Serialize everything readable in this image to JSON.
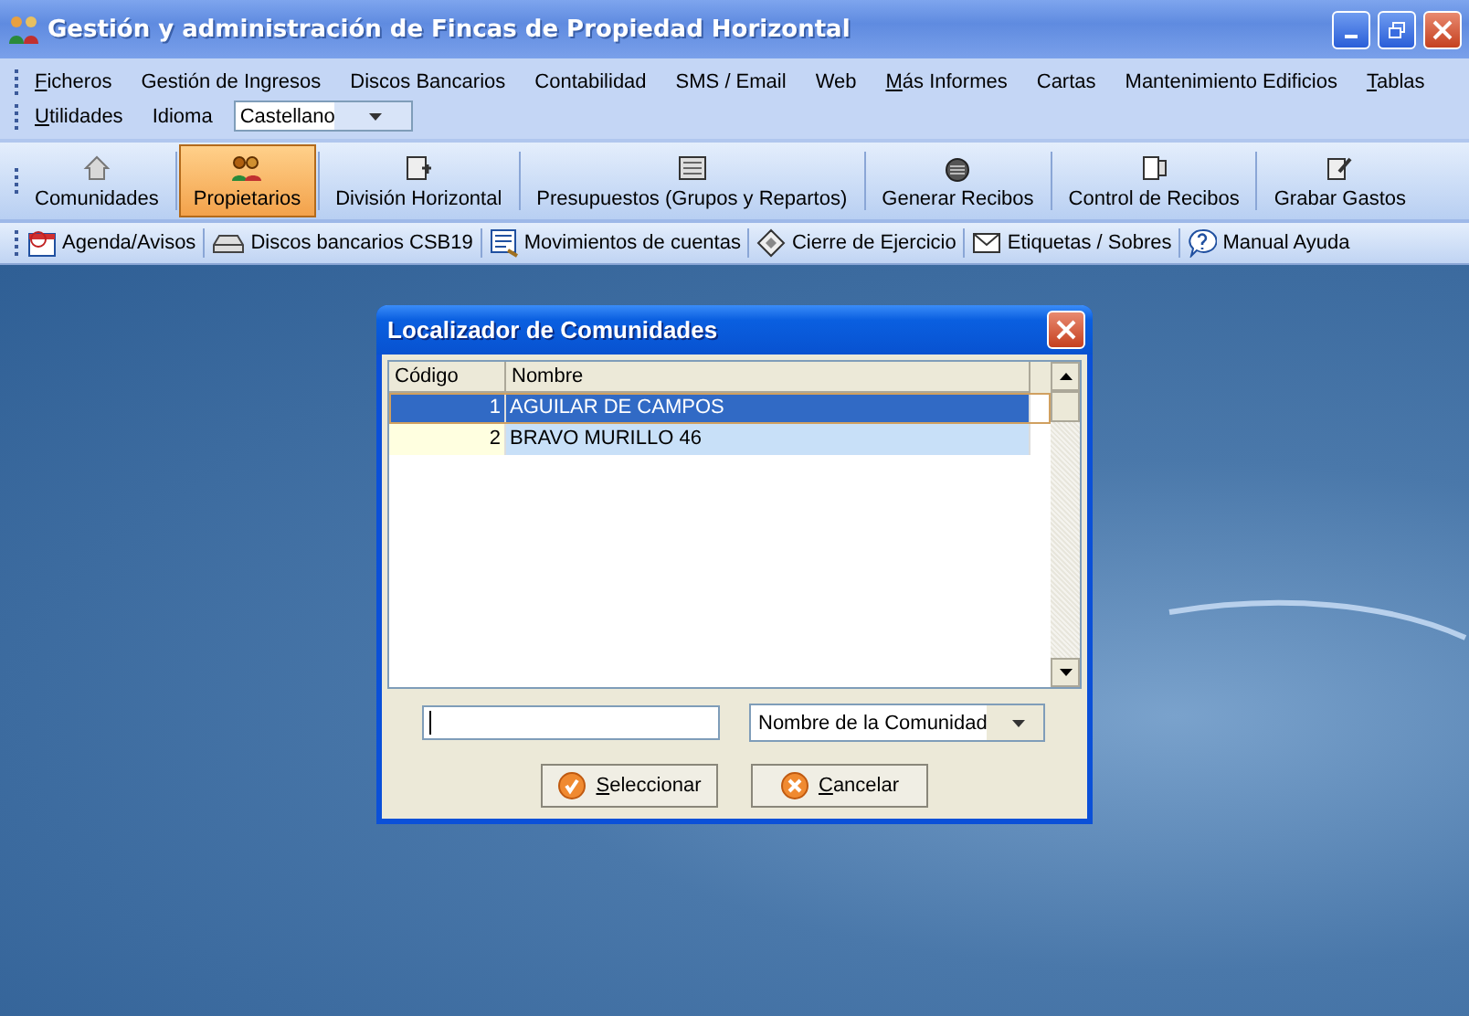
{
  "window": {
    "title": "Gestión y administración de Fincas de Propiedad Horizontal"
  },
  "menu": {
    "items": [
      {
        "label": "Ficheros",
        "mnemonic": true
      },
      {
        "label": "Gestión de Ingresos",
        "mnemonic": false
      },
      {
        "label": "Discos Bancarios",
        "mnemonic": false
      },
      {
        "label": "Contabilidad",
        "mnemonic": false
      },
      {
        "label": "SMS / Email",
        "mnemonic": false
      },
      {
        "label": "Web",
        "mnemonic": false
      },
      {
        "label": "Más Informes",
        "mnemonic": true
      },
      {
        "label": "Cartas",
        "mnemonic": false
      },
      {
        "label": "Mantenimiento Edificios",
        "mnemonic": false
      },
      {
        "label": "Tablas",
        "mnemonic": true
      },
      {
        "label": "Utilidades",
        "mnemonic": true
      }
    ],
    "language_label": "Idioma",
    "language_value": "Castellano"
  },
  "toolbar": [
    {
      "label": "Comunidades",
      "selected": false
    },
    {
      "label": "Propietarios",
      "selected": true
    },
    {
      "label": "División Horizontal",
      "selected": false
    },
    {
      "label": "Presupuestos (Grupos y Repartos)",
      "selected": false
    },
    {
      "label": "Generar Recibos",
      "selected": false
    },
    {
      "label": "Control de Recibos",
      "selected": false
    },
    {
      "label": "Grabar Gastos",
      "selected": false
    }
  ],
  "linkbar": [
    {
      "label": "Agenda/Avisos"
    },
    {
      "label": "Discos bancarios CSB19"
    },
    {
      "label": "Movimientos de cuentas"
    },
    {
      "label": "Cierre de Ejercicio"
    },
    {
      "label": "Etiquetas / Sobres"
    },
    {
      "label": "Manual Ayuda"
    }
  ],
  "dialog": {
    "title": "Localizador de Comunidades",
    "columns": [
      "Código",
      "Nombre"
    ],
    "rows": [
      {
        "code": "1",
        "name": "AGUILAR DE CAMPOS",
        "selected": true
      },
      {
        "code": "2",
        "name": "BRAVO MURILLO 46",
        "selected": false
      }
    ],
    "search_by": "Nombre de la Comunidad",
    "buttons": [
      {
        "label": "Seleccionar",
        "kind": "ok",
        "mnemonic": true
      },
      {
        "label": "Cancelar",
        "kind": "cancel",
        "mnemonic": true
      }
    ]
  }
}
